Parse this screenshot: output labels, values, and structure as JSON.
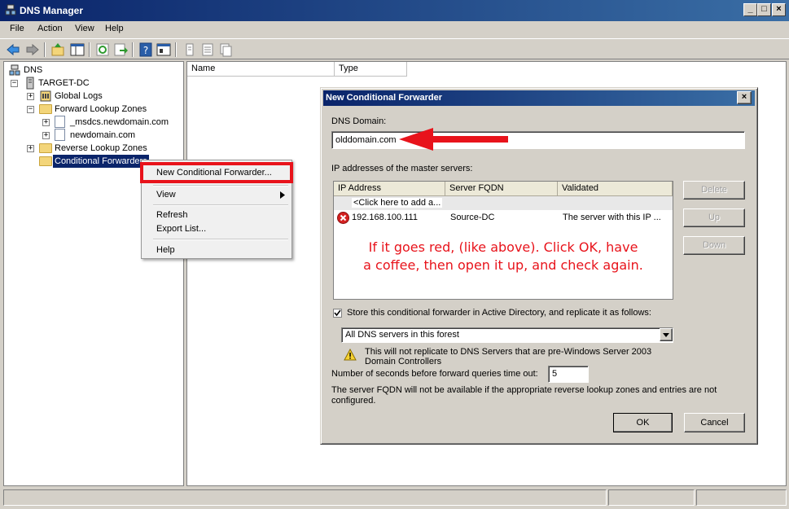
{
  "window": {
    "title": "DNS Manager"
  },
  "menu": [
    "File",
    "Action",
    "View",
    "Help"
  ],
  "toolbar": [
    "back-icon",
    "forward-icon",
    "up-icon",
    "show-hide-tree-icon",
    "refresh-icon",
    "export-icon",
    "help-icon",
    "properties-icon",
    "document-icon",
    "list-icon",
    "copy-icon"
  ],
  "tree": {
    "root": "DNS",
    "server": "TARGET-DC",
    "global_logs": "Global Logs",
    "forward_zones": "Forward Lookup Zones",
    "msdcs": "_msdcs.newdomain.com",
    "newdomain": "newdomain.com",
    "reverse_zones": "Reverse Lookup Zones",
    "conditional": "Conditional Forwarders"
  },
  "list": {
    "col_name": "Name",
    "col_type": "Type"
  },
  "context_menu": {
    "new_forwarder": "New Conditional Forwarder...",
    "view": "View",
    "refresh": "Refresh",
    "export": "Export List...",
    "help": "Help"
  },
  "dialog": {
    "title": "New Conditional Forwarder",
    "dns_domain_label": "DNS Domain:",
    "dns_domain_value": "olddomain.com",
    "masters_label": "IP addresses of the master servers:",
    "grid_headers": {
      "ip": "IP Address",
      "fqdn": "Server FQDN",
      "validated": "Validated"
    },
    "add_row": "<Click here to add a...",
    "rows": [
      {
        "ip": "192.168.100.111",
        "fqdn": "Source-DC",
        "validated": "The server with this IP ..."
      }
    ],
    "buttons": {
      "delete": "Delete",
      "up": "Up",
      "down": "Down",
      "ok": "OK",
      "cancel": "Cancel"
    },
    "annotation_line1": "If it goes red, (like above). Click OK, have",
    "annotation_line2": "a coffee, then open it up, and check again.",
    "store_label": "Store this conditional forwarder in Active Directory, and replicate it as follows:",
    "store_checked": true,
    "replication_value": "All DNS servers in this forest",
    "warning_line1": "This will not replicate to DNS Servers that are pre-Windows Server 2003",
    "warning_line2": "Domain Controllers",
    "timeout_label": "Number of seconds before forward queries time out:",
    "timeout_value": "5",
    "fqdn_note_line1": "The server FQDN will not be available if the appropriate reverse lookup zones and entries are not",
    "fqdn_note_line2": "configured."
  },
  "colors": {
    "annotation_red": "#e8131b",
    "titlebar_blue": "#0a246a",
    "selection_blue": "#0a246a"
  }
}
